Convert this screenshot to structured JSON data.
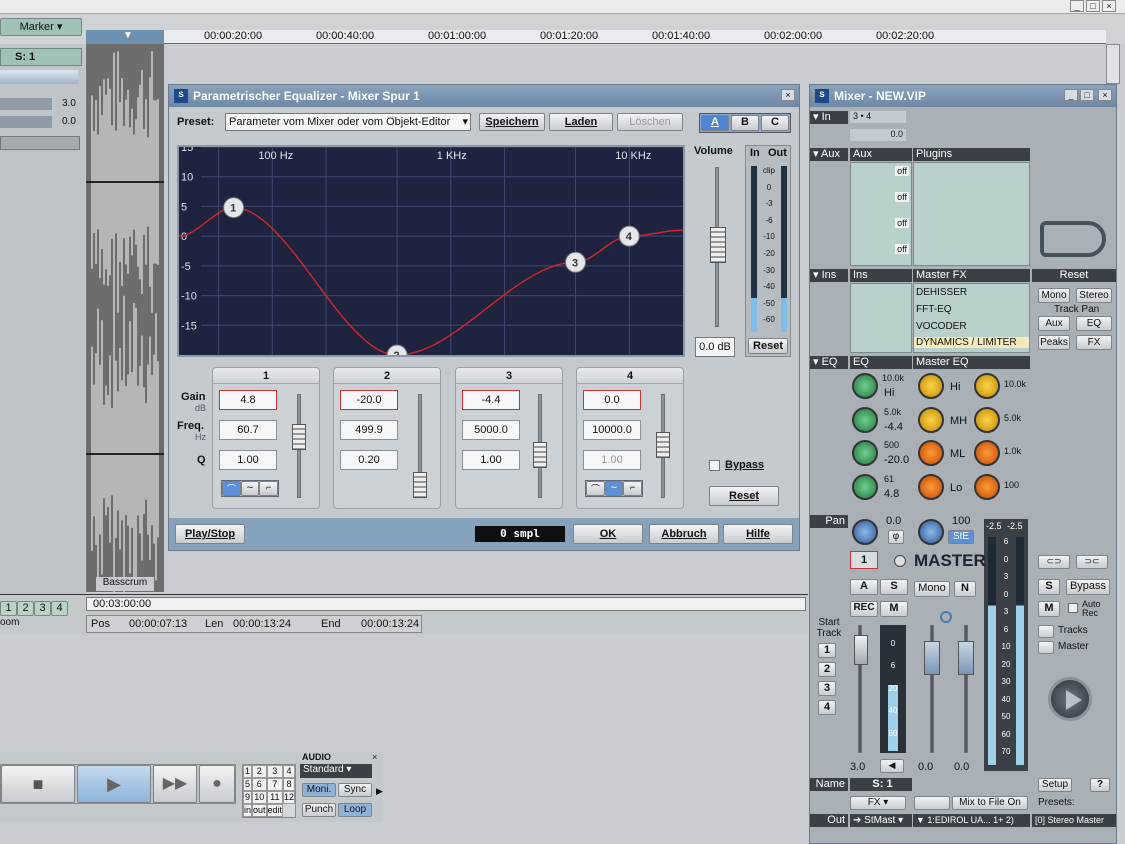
{
  "app": {
    "marker_label": "Marker",
    "track_name": "S: 1",
    "track_values": [
      "3.0",
      "0.0"
    ],
    "clip_name": "Basscrum",
    "ruler_ticks": [
      "00:00:20:00",
      "00:00:40:00",
      "00:01:00:00",
      "00:01:20:00",
      "00:01:40:00",
      "00:02:00:00",
      "00:02:20:00"
    ],
    "timeline_start": "00:03:00:00",
    "pos_label": "Pos",
    "pos_value": "00:00:07:13",
    "len_label": "Len",
    "len_value": "00:00:13:24",
    "end_label": "End",
    "end_value": "00:00:13:24",
    "zoom_label": "oom",
    "zoom_buttons": [
      "1",
      "2",
      "3",
      "4"
    ]
  },
  "eq": {
    "title": "Parametrischer Equalizer - Mixer Spur 1",
    "preset_label": "Preset:",
    "preset_value": "Parameter vom Mixer oder vom Objekt-Editor",
    "save": "Speichern",
    "load": "Laden",
    "delete": "Löschen",
    "abc": [
      "A",
      "B",
      "C"
    ],
    "freq_labels": [
      "100 Hz",
      "1 KHz",
      "10 KHz"
    ],
    "db_labels": [
      "15",
      "10",
      "5",
      "0",
      "-5",
      "-10",
      "-15"
    ],
    "volume_label": "Volume",
    "volume_value": "0.0 dB",
    "meter_in": "In",
    "meter_out": "Out",
    "meter_labels": [
      "clip",
      "0",
      "-3",
      "-6",
      "-10",
      "-20",
      "-30",
      "-40",
      "-50",
      "-60"
    ],
    "meter_reset": "Reset",
    "gain_label": "Gain",
    "db_unit": "dB",
    "freq_label": "Freq.",
    "hz_unit": "Hz",
    "q_label": "Q",
    "bands": [
      {
        "num": "1",
        "gain": "4.8",
        "freq": "60.7",
        "q": "1.00"
      },
      {
        "num": "2",
        "gain": "-20.0",
        "freq": "499.9",
        "q": "0.20"
      },
      {
        "num": "3",
        "gain": "-4.4",
        "freq": "5000.0",
        "q": "1.00"
      },
      {
        "num": "4",
        "gain": "0.0",
        "freq": "10000.0",
        "q": "1.00"
      }
    ],
    "bypass": "Bypass",
    "reset": "Reset",
    "play_stop": "Play/Stop",
    "smpl": "0 smpl",
    "ok": "OK",
    "cancel": "Abbruch",
    "help": "Hilfe"
  },
  "mixer": {
    "title": "Mixer - NEW.VIP",
    "in_label": "In",
    "in_route": "3 • 4",
    "in_value": "0.0",
    "aux_label": "Aux",
    "aux_title": "Aux",
    "plugins_title": "Plugins",
    "aux_offs": [
      "off",
      "off",
      "off",
      "off"
    ],
    "ins_label": "Ins",
    "ins_title": "Ins",
    "master_fx_title": "Master FX",
    "master_fx": [
      "DEHISSER",
      "FFT-EQ",
      "VOCODER",
      "DYNAMICS / LIMITER"
    ],
    "reset": "Reset",
    "mono": "Mono",
    "stereo": "Stereo",
    "track_pan": "Track Pan",
    "aux_btn": "Aux",
    "eq_btn": "EQ",
    "peaks": "Peaks",
    "fx": "FX",
    "eq_label": "EQ",
    "eq_title": "EQ",
    "master_eq_title": "Master EQ",
    "eq_freqs": [
      "10.0k",
      "5.0k",
      "500",
      "61"
    ],
    "eq_gains": [
      "Hi",
      "-4.4",
      "-20.0",
      "4.8"
    ],
    "meq_labels": [
      "Hi",
      "MH",
      "ML",
      "Lo"
    ],
    "meq_values": [
      "10.0k",
      "5.0k",
      "1.0k",
      "100"
    ],
    "pan_label": "Pan",
    "pan_value": "0.0",
    "pan_phi": "φ",
    "master_pan_value": "100",
    "ste": "StE",
    "track_num": "1",
    "master": "MASTER",
    "a": "A",
    "s": "S",
    "rec": "REC",
    "m": "M",
    "mono_btn": "Mono",
    "n": "N",
    "bypass": "Bypass",
    "auto_rec": "Auto Rec",
    "tracks": "Tracks",
    "master_chk": "Master",
    "start_track": "Start Track",
    "start_nums": [
      "1",
      "2",
      "3",
      "4"
    ],
    "fader_track": "3.0",
    "fader_master_l": "0.0",
    "fader_master_r": "0.0",
    "meter_top": [
      "-2.5",
      "-2.5"
    ],
    "meter_labels": [
      "6",
      "0",
      "3",
      "0",
      "3",
      "6",
      "10",
      "20",
      "30",
      "40",
      "50",
      "60",
      "70"
    ],
    "track_meter_labels": [
      "0",
      "6",
      "20",
      "40",
      "60"
    ],
    "name_label": "Name",
    "name_value": "S: 1",
    "fx_btn": "FX",
    "mix_to_file": "Mix to File On",
    "setup": "Setup",
    "help": "?",
    "presets": "Presets:",
    "out_label": "Out",
    "out_value": "StMast",
    "device": "1:EDIROL UA... 1+ 2)",
    "preset_value": "[0] Stereo Master"
  },
  "transport": {
    "audio_label": "AUDIO",
    "mode": "Standard",
    "moni": "Moni.",
    "sync": "Sync",
    "punch": "Punch",
    "loop": "Loop",
    "grid": [
      "1",
      "2",
      "3",
      "4",
      "5",
      "6",
      "7",
      "8",
      "9",
      "10",
      "11",
      "12"
    ],
    "grid_bottom": [
      "in",
      "out",
      "edit"
    ]
  },
  "chart_data": {
    "type": "line",
    "x_axis": "log frequency",
    "ylim": [
      -20,
      15
    ],
    "tick_labels_x": [
      "100 Hz",
      "1 KHz",
      "10 KHz"
    ],
    "tick_labels_y": [
      "15",
      "10",
      "5",
      "0",
      "-5",
      "-10",
      "-15"
    ],
    "nodes": [
      {
        "label": "1",
        "freq": 60.7,
        "gain": 4.8
      },
      {
        "label": "2",
        "freq": 499.9,
        "gain": -20.0
      },
      {
        "label": "3",
        "freq": 5000,
        "gain": -4.4
      },
      {
        "label": "4",
        "freq": 10000,
        "gain": 0.0
      }
    ]
  },
  "colors": {
    "curve": "#d9252d",
    "plot_bg": "#1e2440",
    "title_bar": "#7a94b0",
    "mixer_pane": "#b9d0cc"
  }
}
